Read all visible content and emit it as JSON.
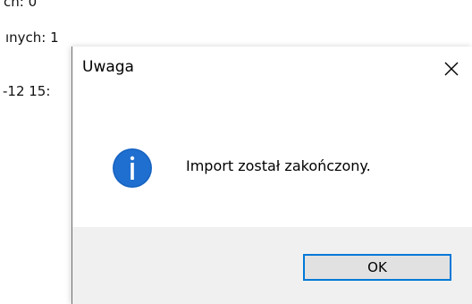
{
  "background_window": {
    "lines": [
      "ch: 0",
      "ınych: 1",
      "-12 15:"
    ]
  },
  "dialog": {
    "title": "Uwaga",
    "message": "Import został zakończony.",
    "ok_label": "OK",
    "icon": "info-icon",
    "accent_color": "#0078d7",
    "icon_color": "#1f6fd0",
    "footer_color": "#f0f0f0"
  }
}
